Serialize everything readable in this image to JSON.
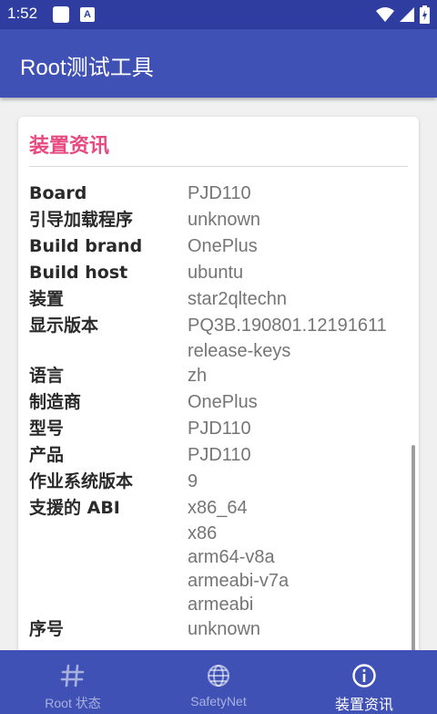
{
  "status_bar": {
    "time": "1:52",
    "notification_icon_letter": "A"
  },
  "app_bar": {
    "title": "Root测试工具"
  },
  "card": {
    "title": "装置资讯",
    "rows": [
      {
        "key": "Board",
        "values": [
          "PJD110"
        ]
      },
      {
        "key": "引导加载程序",
        "values": [
          "unknown"
        ]
      },
      {
        "key": "Build brand",
        "values": [
          "OnePlus"
        ]
      },
      {
        "key": "Build host",
        "values": [
          "ubuntu"
        ]
      },
      {
        "key": "装置",
        "values": [
          "star2qltechn"
        ]
      },
      {
        "key": "显示版本",
        "values": [
          "PQ3B.190801.12191611",
          "release-keys"
        ]
      },
      {
        "key": "语言",
        "values": [
          "zh"
        ]
      },
      {
        "key": "制造商",
        "values": [
          "OnePlus"
        ]
      },
      {
        "key": "型号",
        "values": [
          "PJD110"
        ]
      },
      {
        "key": "产品",
        "values": [
          "PJD110"
        ]
      },
      {
        "key": "作业系统版本",
        "values": [
          "9"
        ]
      },
      {
        "key": "支援的 ABI",
        "values": [
          "x86_64",
          "x86",
          "arm64-v8a",
          "armeabi-v7a",
          "armeabi"
        ]
      },
      {
        "key": "序号",
        "values": [
          "unknown"
        ]
      }
    ]
  },
  "bottom_nav": {
    "items": [
      {
        "label": "Root 状态",
        "icon": "hash-icon",
        "active": false
      },
      {
        "label": "SafetyNet",
        "icon": "globe-icon",
        "active": false
      },
      {
        "label": "装置资讯",
        "icon": "info-icon",
        "active": true
      }
    ]
  },
  "colors": {
    "status_bar": "#2e3d9f",
    "app_bar": "#3f51b5",
    "accent": "#e84a7f"
  }
}
